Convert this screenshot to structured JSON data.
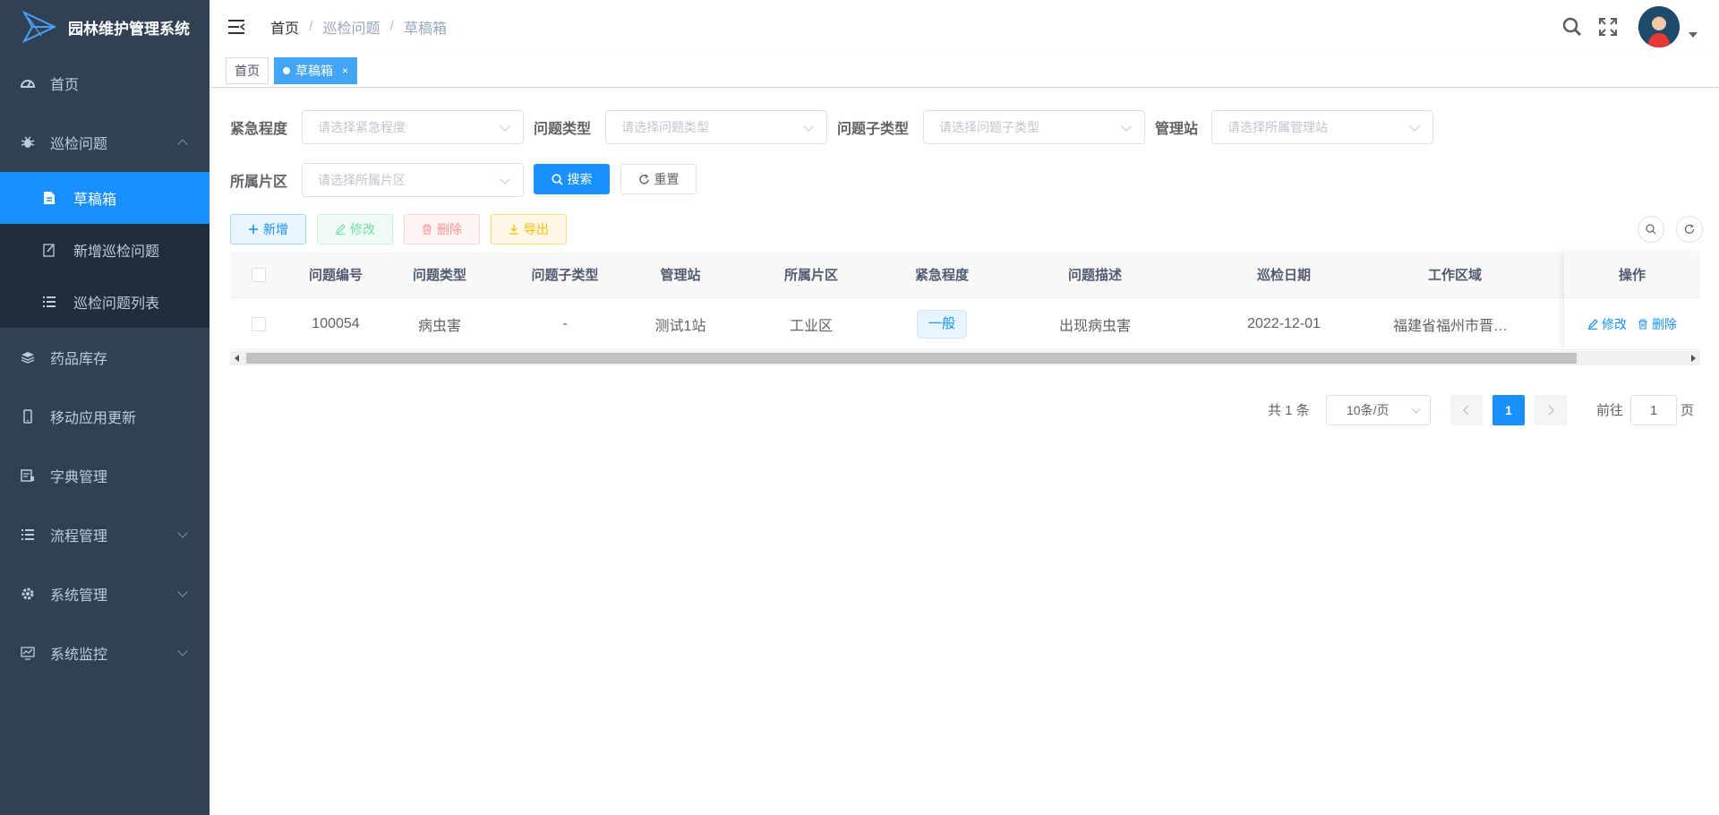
{
  "app": {
    "title": "园林维护管理系统"
  },
  "sidebar": {
    "items": [
      {
        "label": "首页",
        "icon": "dashboard-icon"
      },
      {
        "label": "巡检问题",
        "icon": "bug-icon",
        "expanded": true,
        "children": [
          {
            "label": "草稿箱",
            "icon": "document-icon",
            "active": true
          },
          {
            "label": "新增巡检问题",
            "icon": "edit-icon"
          },
          {
            "label": "巡检问题列表",
            "icon": "list-icon"
          }
        ]
      },
      {
        "label": "药品库存",
        "icon": "layers-icon"
      },
      {
        "label": "移动应用更新",
        "icon": "phone-icon"
      },
      {
        "label": "字典管理",
        "icon": "dict-icon"
      },
      {
        "label": "流程管理",
        "icon": "list-icon"
      },
      {
        "label": "系统管理",
        "icon": "gear-icon"
      },
      {
        "label": "系统监控",
        "icon": "monitor-icon"
      }
    ]
  },
  "header": {
    "breadcrumb": [
      "首页",
      "巡检问题",
      "草稿箱"
    ]
  },
  "tags": [
    {
      "label": "首页",
      "active": false
    },
    {
      "label": "草稿箱",
      "active": true,
      "close": "×"
    }
  ],
  "filters": {
    "urgency": {
      "label": "紧急程度",
      "placeholder": "请选择紧急程度"
    },
    "problem_type": {
      "label": "问题类型",
      "placeholder": "请选择问题类型"
    },
    "sub_type": {
      "label": "问题子类型",
      "placeholder": "请选择问题子类型"
    },
    "station": {
      "label": "管理站",
      "placeholder": "请选择所属管理站"
    },
    "zone": {
      "label": "所属片区",
      "placeholder": "请选择所属片区"
    },
    "search_label": "搜索",
    "reset_label": "重置"
  },
  "toolbar": {
    "add_label": "新增",
    "edit_label": "修改",
    "delete_label": "删除",
    "export_label": "导出"
  },
  "table": {
    "columns": [
      "问题编号",
      "问题类型",
      "问题子类型",
      "管理站",
      "所属片区",
      "紧急程度",
      "问题描述",
      "巡检日期",
      "工作区域",
      "操作"
    ],
    "rows": [
      {
        "id": "100054",
        "type": "病虫害",
        "sub_type": "-",
        "station": "测试1站",
        "zone": "工业区",
        "urgency": "一般",
        "desc": "出现病虫害",
        "date": "2022-12-01",
        "area": "福建省福州市晋安区",
        "edit": "修改",
        "delete": "删除"
      }
    ]
  },
  "pagination": {
    "total_text": "共 1 条",
    "page_size": "10条/页",
    "current_page": "1",
    "goto_label": "前往",
    "goto_value": "1",
    "page_suffix": "页"
  },
  "colors": {
    "primary": "#1890ff",
    "sidebar_bg": "#304156",
    "submenu_bg": "#1f2d3d"
  }
}
